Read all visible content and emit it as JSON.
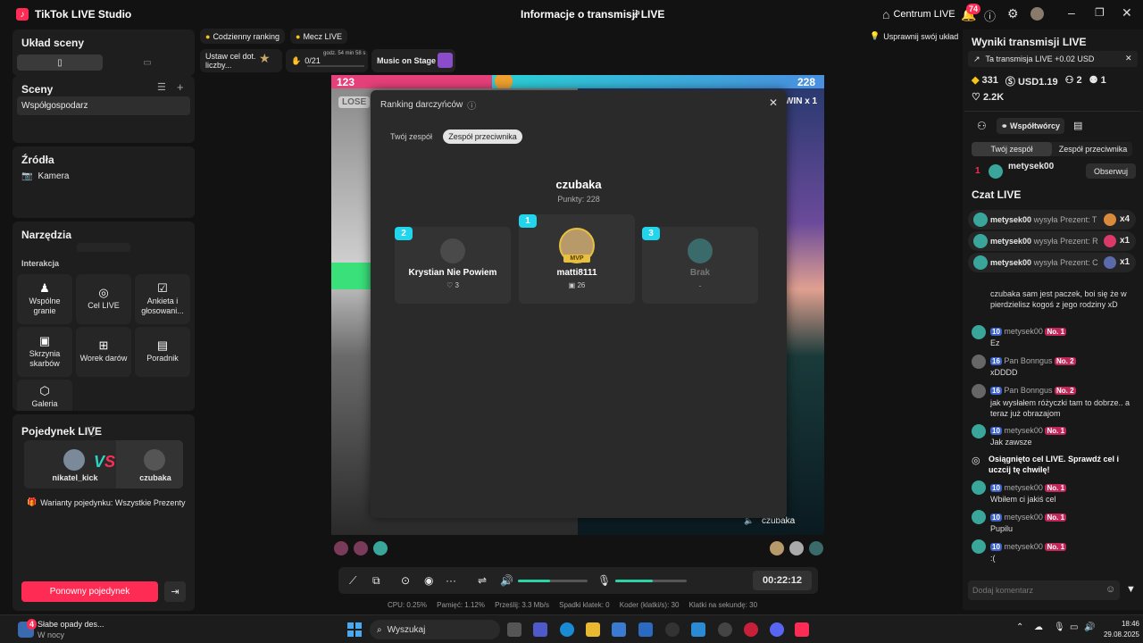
{
  "app": {
    "title": "TikTok LIVE Studio",
    "center_title": "Informacje o transmisji LIVE",
    "live_center": "Centrum LIVE",
    "notif_count": "74"
  },
  "left": {
    "scene_layout_title": "Układ sceny",
    "scenes_title": "Sceny",
    "scene_item": "Współgospodarz",
    "sources_title": "Źródła",
    "source_item": "Kamera",
    "tools_title": "Narzędzia",
    "interaction_title": "Interakcja",
    "tools": [
      "Wspólne granie",
      "Cel LIVE",
      "Ankieta i głosowani...",
      "Skrzynia skarbów",
      "Worek darów",
      "Poradnik",
      "Galeria"
    ],
    "duel_title": "Pojedynek LIVE",
    "duel_left": "nikatel_kick",
    "duel_right": "czubaka",
    "duel_variant": "Warianty pojedynku: Wszystkie Prezenty",
    "rematch_button": "Ponowny pojedynek"
  },
  "topbar": {
    "daily_ranking": "Codzienny ranking",
    "live_match": "Mecz LIVE",
    "goal_text": "Ustaw cel dot. liczby...",
    "goal_progress": "0/21",
    "goal_timer": "godz. 54 min 58 s",
    "music": "Music on Stage",
    "improve_layout": "Usprawnij swój układ"
  },
  "battle": {
    "left_score": "123",
    "right_score": "228",
    "lose": "LOSE",
    "win": "WIN x 1",
    "streamer_label": "czubaka"
  },
  "modal": {
    "title": "Ranking darczyńców",
    "tab_yours": "Twój zespół",
    "tab_opponent": "Zespół przeciwnika",
    "team_name": "czubaka",
    "points": "Punkty: 228",
    "cards": [
      {
        "rank": "2",
        "name": "Krystian Nie Powiem",
        "stat": "3"
      },
      {
        "rank": "1",
        "name": "matti8111",
        "stat": "26",
        "mvp": "MVP"
      },
      {
        "rank": "3",
        "name": "Brak",
        "stat": "-"
      }
    ]
  },
  "controls": {
    "timer": "00:22:12"
  },
  "stats": {
    "cpu": "CPU: 0.25%",
    "memory": "Pamięć: 1.12%",
    "upload": "Prześlij: 3.3 Mb/s",
    "dropped": "Spadki klatek: 0",
    "encoder": "Koder (klatki/s): 30",
    "fps": "Klatki na sekundę: 30"
  },
  "right": {
    "results_title": "Wyniki transmisji LIVE",
    "promo": "Ta transmisja LIVE +0.02 USD",
    "coins": "331",
    "usd": "USD1.19",
    "viewers": "2",
    "followers": "1",
    "likes": "2.2K",
    "collaborators": "Współtwórcy",
    "tab_yours": "Twój zespół",
    "tab_opponent": "Zespół przeciwnika",
    "top_rank": "1",
    "top_user": "metysek00",
    "follow_button": "Obserwuj",
    "chat_title": "Czat LIVE",
    "gifts": [
      {
        "user": "metysek00",
        "text": "wysyła Prezent: T",
        "count": "x4"
      },
      {
        "user": "metysek00",
        "text": "wysyła Prezent: R",
        "count": "x1"
      },
      {
        "user": "metysek00",
        "text": "wysyła Prezent: C",
        "count": "x1"
      }
    ],
    "first_message": "czubaka sam jest paczek, boi się że w pierdzielisz kogoś z jego rodziny xD",
    "messages": [
      {
        "level": "10",
        "user": "metysek00",
        "rank": "No. 1",
        "text": "Ez"
      },
      {
        "level": "16",
        "user": "Pan Bonngus",
        "rank": "No. 2",
        "text": "xDDDD"
      },
      {
        "level": "16",
        "user": "Pan Bonngus",
        "rank": "No. 2",
        "text": "jak wysłałem różyczki tam to dobrze.. a teraz już obrazajom"
      },
      {
        "level": "10",
        "user": "metysek00",
        "rank": "No. 1",
        "text": "Jak zawsze"
      }
    ],
    "system_message": "Osiągnięto cel LIVE. Sprawdź cel i uczcij tę chwilę!",
    "messages2": [
      {
        "level": "10",
        "user": "metysek00",
        "rank": "No. 1",
        "text": "Wbiłem ci jakiś cel"
      },
      {
        "level": "10",
        "user": "metysek00",
        "rank": "No. 1",
        "text": "Pupilu"
      },
      {
        "level": "10",
        "user": "metysek00",
        "rank": "No. 1",
        "text": ":("
      }
    ],
    "comment_placeholder": "Dodaj komentarz"
  },
  "taskbar": {
    "weather_title": "Słabe opady des...",
    "weather_sub": "W nocy",
    "search": "Wyszukaj",
    "time": "18:46",
    "date": "29.08.2025",
    "weather_badge": "4"
  }
}
